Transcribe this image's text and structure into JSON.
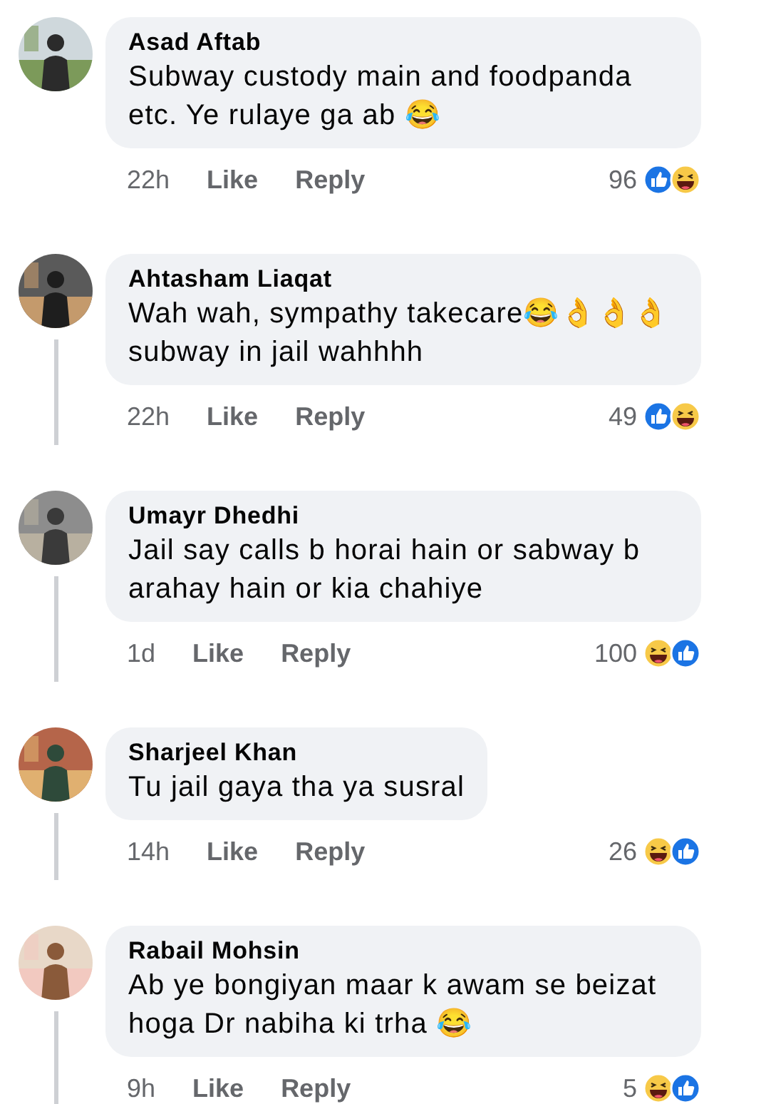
{
  "comments": [
    {
      "author": "Asad Aftab",
      "text": "Subway custody main and foodpanda etc. Ye rulaye ga ab 😂",
      "time": "22h",
      "actions": [
        "Like",
        "Reply"
      ],
      "reaction_count": "96",
      "reactions": [
        {
          "kind": "like"
        },
        {
          "kind": "haha"
        }
      ],
      "thread_line": false
    },
    {
      "author": "Ahtasham Liaqat",
      "text": "Wah wah, sympathy takecare😂👌👌👌 subway in jail wahhhh",
      "time": "22h",
      "actions": [
        "Like",
        "Reply"
      ],
      "reaction_count": "49",
      "reactions": [
        {
          "kind": "like"
        },
        {
          "kind": "haha"
        }
      ],
      "thread_line": true
    },
    {
      "author": "Umayr Dhedhi",
      "text": "Jail say calls b horai hain or sabway b arahay hain or kia chahiye",
      "time": "1d",
      "actions": [
        "Like",
        "Reply"
      ],
      "reaction_count": "100",
      "reactions": [
        {
          "kind": "haha"
        },
        {
          "kind": "like"
        }
      ],
      "thread_line": true
    },
    {
      "author": "Sharjeel Khan",
      "text": "Tu jail gaya tha ya susral",
      "time": "14h",
      "actions": [
        "Like",
        "Reply"
      ],
      "reaction_count": "26",
      "reactions": [
        {
          "kind": "haha"
        },
        {
          "kind": "like"
        }
      ],
      "thread_line": true
    },
    {
      "author": "Rabail Mohsin",
      "text": "Ab ye bongiyan maar k awam se beizat hoga Dr nabiha ki trha 😂",
      "time": "9h",
      "actions": [
        "Like",
        "Reply"
      ],
      "reaction_count": "5",
      "reactions": [
        {
          "kind": "haha"
        },
        {
          "kind": "like"
        }
      ],
      "thread_line": true
    }
  ]
}
